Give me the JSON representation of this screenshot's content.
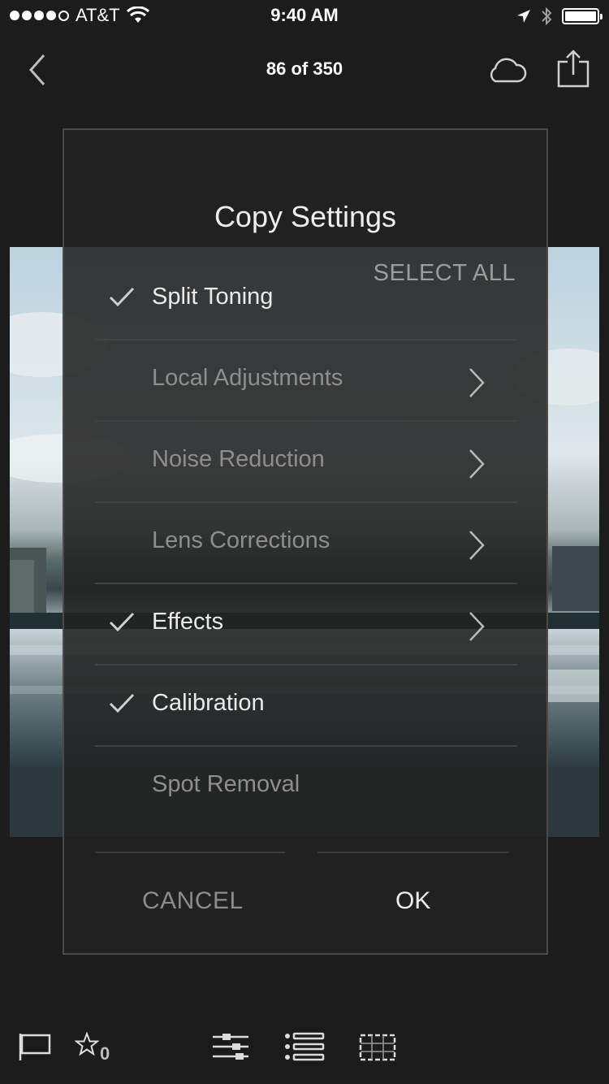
{
  "status_bar": {
    "carrier": "AT&T",
    "time": "9:40 AM",
    "signal_bars": 4,
    "signal_total": 5
  },
  "nav": {
    "title": "86 of 350",
    "back_icon": "chevron-left-icon",
    "cloud_icon": "cloud-icon",
    "share_icon": "share-icon"
  },
  "dialog": {
    "title": "Copy Settings",
    "select_all": "SELECT ALL",
    "items": [
      {
        "label": "Split Toning",
        "checked": true,
        "has_submenu": false
      },
      {
        "label": "Local Adjustments",
        "checked": false,
        "has_submenu": true
      },
      {
        "label": "Noise Reduction",
        "checked": false,
        "has_submenu": true
      },
      {
        "label": "Lens Corrections",
        "checked": false,
        "has_submenu": true
      },
      {
        "label": "Effects",
        "checked": true,
        "has_submenu": true
      },
      {
        "label": "Calibration",
        "checked": true,
        "has_submenu": false
      },
      {
        "label": "Spot Removal",
        "checked": false,
        "has_submenu": false
      }
    ],
    "cancel_label": "CANCEL",
    "ok_label": "OK"
  },
  "toolbar": {
    "star_count": "0",
    "items": [
      "flag-icon",
      "star-icon",
      "sliders-icon",
      "list-icon",
      "crop-icon"
    ]
  },
  "colors": {
    "background": "#1c1c1c",
    "dialog_bg": "#222222",
    "text_active": "#eaeaea",
    "text_inactive": "#8e8e8e"
  }
}
